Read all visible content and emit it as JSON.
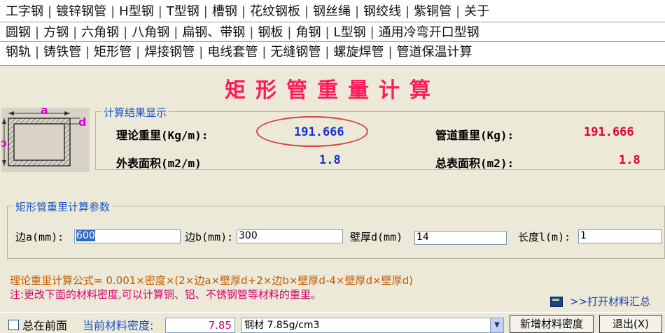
{
  "tabs": {
    "row1": [
      "工字钢",
      "镀锌钢管",
      "H型钢",
      "T型钢",
      "槽钢",
      "花纹钢板",
      "钢丝绳",
      "钢绞线",
      "紫铜管",
      "关于"
    ],
    "row2": [
      "圆钢",
      "方钢",
      "六角钢",
      "八角钢",
      "扁钢、带钢",
      "钢板",
      "角钢",
      "L型钢",
      "通用冷弯开口型钢"
    ],
    "row3": [
      "钢轨",
      "铸铁管",
      "矩形管",
      "焊接钢管",
      "电线套管",
      "无缝钢管",
      "螺旋焊管",
      "管道保温计算"
    ],
    "active": "矩形管"
  },
  "title": "矩形管重量计算",
  "diagram": {
    "label_a": "a",
    "label_b": "b",
    "label_d": "d"
  },
  "results": {
    "legend": "计算结果显示",
    "theory_weight_label": "理论重里(Kg/m):",
    "theory_weight_value": "191.666",
    "pipe_weight_label": "管道重里(Kg):",
    "pipe_weight_value": "191.666",
    "outer_area_label": "外表面积(m2/m)",
    "outer_area_value": "1.8",
    "total_area_label": "总表面积(m2):",
    "total_area_value": "1.8",
    "colors": {
      "blue": "#1a2fd0",
      "red": "#e0002a"
    }
  },
  "params": {
    "legend": "矩形管重里计算参数",
    "side_a_label": "边a(mm):",
    "side_a_value": "600",
    "side_b_label": "边b(mm):",
    "side_b_value": "300",
    "thickness_label": "壁厚d(mm)",
    "thickness_value": "14",
    "length_label": "长度l(m):",
    "length_value": "1"
  },
  "formula": "理论重里计算公式= 0.001×密度×(2×边a×壁厚d+2×边b×壁厚d-4×壁厚d×壁厚d)",
  "note": "注:更改下面的材料密度,可以计算铜、铝、不锈钢管等材料的重里。",
  "open_link": ">>打开材料汇总",
  "bottom": {
    "always_on_top": "总在前面",
    "density_label": "当前材料密度:",
    "density_value": "7.85",
    "material": "钢材 7.85g/cm3",
    "add_density_button": "新增材料密度",
    "exit_button": "退出(X)"
  }
}
